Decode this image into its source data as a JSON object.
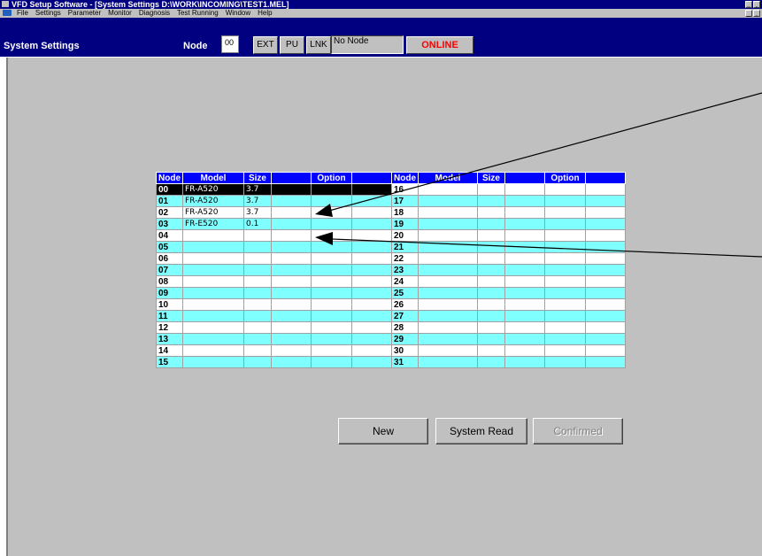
{
  "window": {
    "title": "VFD Setup Software - [System Settings D:\\WORK\\INCOMING\\TEST1.MEL]",
    "caption_buttons": [
      "_",
      "¸",
      "×"
    ]
  },
  "menu": [
    "File",
    "Settings",
    "Parameter",
    "Monitor",
    "Diagnosis",
    "Test Running",
    "Window",
    "Help"
  ],
  "toolbar": {
    "screen_title": "System Settings",
    "node_label": "Node",
    "node_value": "00",
    "ext": "EXT",
    "pu": "PU",
    "lnk": "LNK",
    "status": "No Node",
    "online": "ONLINE"
  },
  "table": {
    "headers": [
      "Node",
      "Model",
      "Size",
      "",
      "Option",
      ""
    ],
    "left_rows": [
      {
        "node": "00",
        "model": "FR-A520",
        "size": "3.7"
      },
      {
        "node": "01",
        "model": "FR-A520",
        "size": "3.7"
      },
      {
        "node": "02",
        "model": "FR-A520",
        "size": "3.7"
      },
      {
        "node": "03",
        "model": "FR-E520",
        "size": "0.1"
      },
      {
        "node": "04",
        "model": "",
        "size": ""
      },
      {
        "node": "05",
        "model": "",
        "size": ""
      },
      {
        "node": "06",
        "model": "",
        "size": ""
      },
      {
        "node": "07",
        "model": "",
        "size": ""
      },
      {
        "node": "08",
        "model": "",
        "size": ""
      },
      {
        "node": "09",
        "model": "",
        "size": ""
      },
      {
        "node": "10",
        "model": "",
        "size": ""
      },
      {
        "node": "11",
        "model": "",
        "size": ""
      },
      {
        "node": "12",
        "model": "",
        "size": ""
      },
      {
        "node": "13",
        "model": "",
        "size": ""
      },
      {
        "node": "14",
        "model": "",
        "size": ""
      },
      {
        "node": "15",
        "model": "",
        "size": ""
      }
    ],
    "right_rows": [
      {
        "node": "16"
      },
      {
        "node": "17"
      },
      {
        "node": "18"
      },
      {
        "node": "19"
      },
      {
        "node": "20"
      },
      {
        "node": "21"
      },
      {
        "node": "22"
      },
      {
        "node": "23"
      },
      {
        "node": "24"
      },
      {
        "node": "25"
      },
      {
        "node": "26"
      },
      {
        "node": "27"
      },
      {
        "node": "28"
      },
      {
        "node": "29"
      },
      {
        "node": "30"
      },
      {
        "node": "31"
      }
    ]
  },
  "buttons": {
    "new": "New",
    "system_read": "System Read",
    "confirmed": "Confirmed"
  },
  "colors": {
    "title_bar": "#000080",
    "header": "#0000ff",
    "row_alt": "#80ffff",
    "online": "#ff0000"
  }
}
